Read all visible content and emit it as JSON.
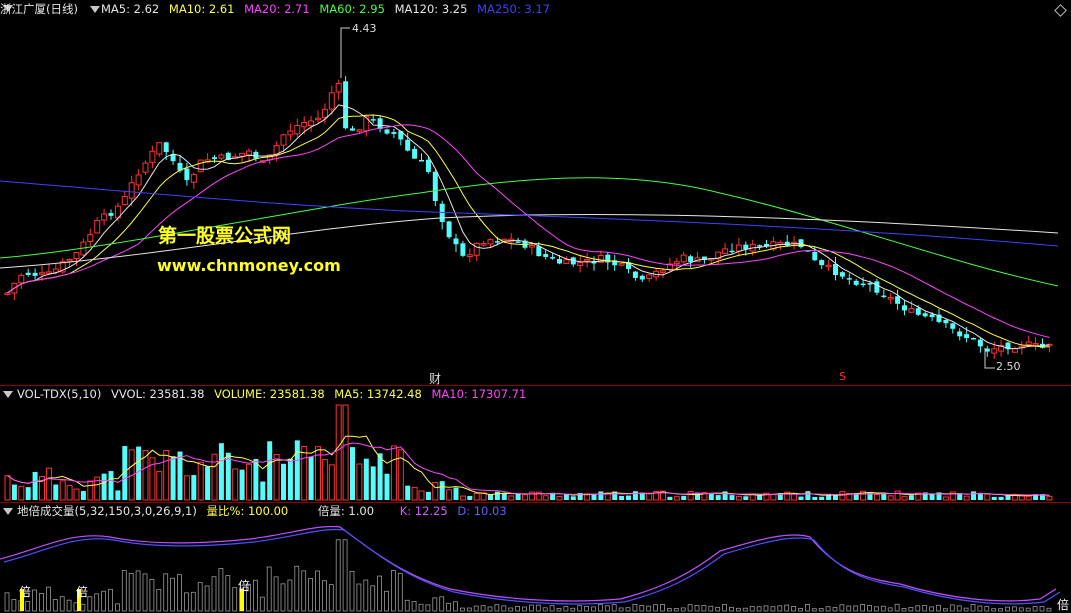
{
  "main_panel": {
    "title": "浙江广厦(日线)",
    "indicators": [
      {
        "label": "MA5: 2.62",
        "color": "#e6e6e6"
      },
      {
        "label": "MA10: 2.61",
        "color": "#ffff44"
      },
      {
        "label": "MA20: 2.71",
        "color": "#ff44ff"
      },
      {
        "label": "MA60: 2.95",
        "color": "#44ff44"
      },
      {
        "label": "MA120: 3.25",
        "color": "#e6e6e6"
      },
      {
        "label": "MA250: 3.17",
        "color": "#4040ff"
      }
    ],
    "high_label": "4.43",
    "low_label": "2.50",
    "marker_cai": "财",
    "marker_s": "S",
    "watermark_line1": "第一股票公式网",
    "watermark_line2": "www.chnmoney.com"
  },
  "volume_panel": {
    "title": "VOL-TDX(5,10)",
    "vvol": "VVOL: 23581.38",
    "volume": "VOLUME: 23581.38",
    "ma5": "MA5: 13742.48",
    "ma10": "MA10: 17307.71"
  },
  "indicator_panel": {
    "title": "地倍成交量(5,32,150,3,0,26,9,1)",
    "ratio": "量比%: 100.00",
    "multiple": "倍量: 1.00",
    "k": "K: 12.25",
    "d": "D: 10.03",
    "bei_label": "倍"
  },
  "colors": {
    "up": "#ff3232",
    "down": "#54fcfc",
    "ma5": "#e6e6e6",
    "ma10": "#ffff44",
    "ma20": "#ff44ff",
    "ma60": "#44ff44",
    "ma120": "#e6e6e6",
    "ma250": "#4040ff",
    "separator": "#8b0000"
  }
}
